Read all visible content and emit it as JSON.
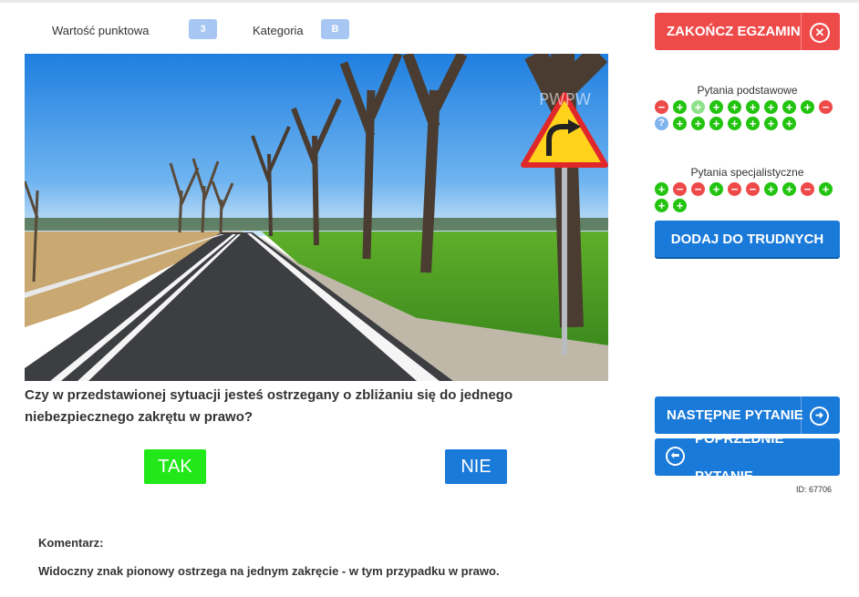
{
  "meta": {
    "points_label": "Wartość punktowa",
    "points_value": "3",
    "category_label": "Kategoria",
    "category_value": "B"
  },
  "question": {
    "text": "Czy w przedstawionej sytuacji jesteś ostrzegany o zbliżaniu się do jednego niebezpiecznego zakrętu w prawo?",
    "image_watermark": "PWPW",
    "answers": {
      "yes": "TAK",
      "no": "NIE"
    }
  },
  "comment": {
    "label": "Komentarz:",
    "text": "Widoczny znak pionowy ostrzega na jednym zakręcie - w tym przypadku w prawo."
  },
  "sidebar": {
    "end_exam_label": "ZAKOŃCZ EGZAMIN",
    "basic_title": "Pytania podstawowe",
    "basic_rows": [
      [
        "minus",
        "plus",
        "plus-light",
        "plus",
        "plus",
        "plus",
        "plus",
        "plus",
        "plus",
        "minus"
      ],
      [
        "unknown",
        "plus",
        "plus",
        "plus",
        "plus",
        "plus",
        "plus",
        "plus"
      ]
    ],
    "special_title": "Pytania specjalistyczne",
    "special_rows": [
      [
        "plus",
        "minus",
        "minus",
        "plus",
        "minus",
        "minus",
        "plus",
        "plus",
        "minus",
        "plus"
      ],
      [
        "plus",
        "plus"
      ]
    ],
    "add_hard_label": "DODAJ DO TRUDNYCH",
    "next_label": "NASTĘPNE PYTANIE",
    "prev_label": "POPRZEDNIE PYTANIE",
    "id_text": "ID: 67706"
  },
  "colors": {
    "red": "#ef4a4a",
    "blue": "#1a7ad9",
    "green": "#22e81a",
    "badge": "#a7c7f2"
  }
}
